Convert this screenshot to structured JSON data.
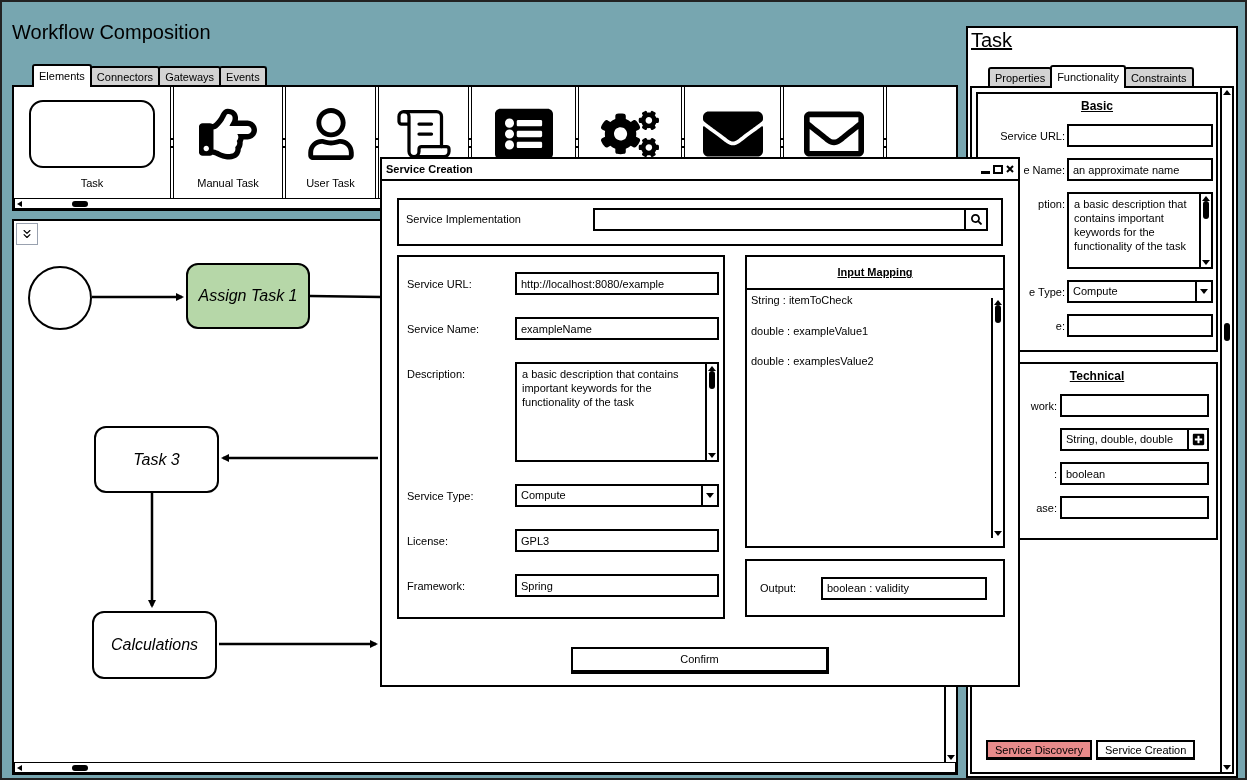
{
  "window": {
    "title": "Workflow Composition"
  },
  "palette_tabs": [
    {
      "label": "Elements",
      "selected": true
    },
    {
      "label": "Connectors",
      "selected": false
    },
    {
      "label": "Gateways",
      "selected": false
    },
    {
      "label": "Events",
      "selected": false
    }
  ],
  "palette_items": [
    {
      "kind": "task",
      "label": "Task"
    },
    {
      "kind": "hand",
      "label": "Manual Task"
    },
    {
      "kind": "user",
      "label": "User Task"
    },
    {
      "kind": "script"
    },
    {
      "kind": "list"
    },
    {
      "kind": "gears"
    },
    {
      "kind": "mail_filled"
    },
    {
      "kind": "mail"
    },
    {
      "kind": "empty"
    }
  ],
  "diagram": {
    "nodes": [
      {
        "kind": "start"
      },
      {
        "kind": "task",
        "label": "Assign Task 1",
        "color": "#b6d7a8"
      },
      {
        "kind": "task",
        "label": "Task 3",
        "color": "#ffffff"
      },
      {
        "kind": "task",
        "label": "Calculations",
        "color": "#ffffff"
      }
    ]
  },
  "task_panel": {
    "title": "Task",
    "tabs": [
      {
        "label": "Properties",
        "selected": false
      },
      {
        "label": "Functionality",
        "selected": true
      },
      {
        "label": "Constraints",
        "selected": false
      }
    ],
    "basic": {
      "heading": "Basic",
      "fields": [
        {
          "kind": "text",
          "label": "Service URL:"
        },
        {
          "kind": "text",
          "label": "e Name:",
          "value": "an approximate name"
        },
        {
          "kind": "textarea",
          "label": "ption:",
          "value": "a basic description that contains important keywords for the functionality of the task"
        },
        {
          "kind": "select",
          "label": "e Type:",
          "value": "Compute"
        },
        {
          "kind": "text",
          "label": "e:"
        }
      ]
    },
    "technical": {
      "heading": "Technical",
      "fields": [
        {
          "kind": "text",
          "label": "work:"
        },
        {
          "kind": "add",
          "value": "String, double, double"
        },
        {
          "kind": "text",
          "label": ":",
          "value": "boolean"
        },
        {
          "kind": "text",
          "label": "ase:"
        }
      ]
    },
    "buttons": [
      {
        "label": "Service Discovery",
        "color": "#e88b8b"
      },
      {
        "label": "Service Creation",
        "color": "#ffffff"
      }
    ]
  },
  "dialog": {
    "title": "Service Creation",
    "implementation_label": "Service Implementation",
    "fields": [
      {
        "kind": "text",
        "label": "Service URL:",
        "value": "http://localhost:8080/example"
      },
      {
        "kind": "text",
        "label": "Service Name:",
        "value": "exampleName"
      },
      {
        "kind": "textarea",
        "label": "Description:",
        "value": "a basic description that contains important keywords for the functionality of the task"
      },
      {
        "kind": "select",
        "label": "Service Type:",
        "value": "Compute"
      },
      {
        "kind": "text",
        "label": "License:",
        "value": "GPL3"
      },
      {
        "kind": "text",
        "label": "Framework:",
        "value": "Spring"
      }
    ],
    "input_mapping": {
      "title": "Input Mapping",
      "items": [
        "String : itemToCheck",
        "double : exampleValue1",
        "double : examplesValue2"
      ]
    },
    "output": {
      "label": "Output:",
      "value": "boolean : validity"
    },
    "confirm": "Confirm"
  }
}
